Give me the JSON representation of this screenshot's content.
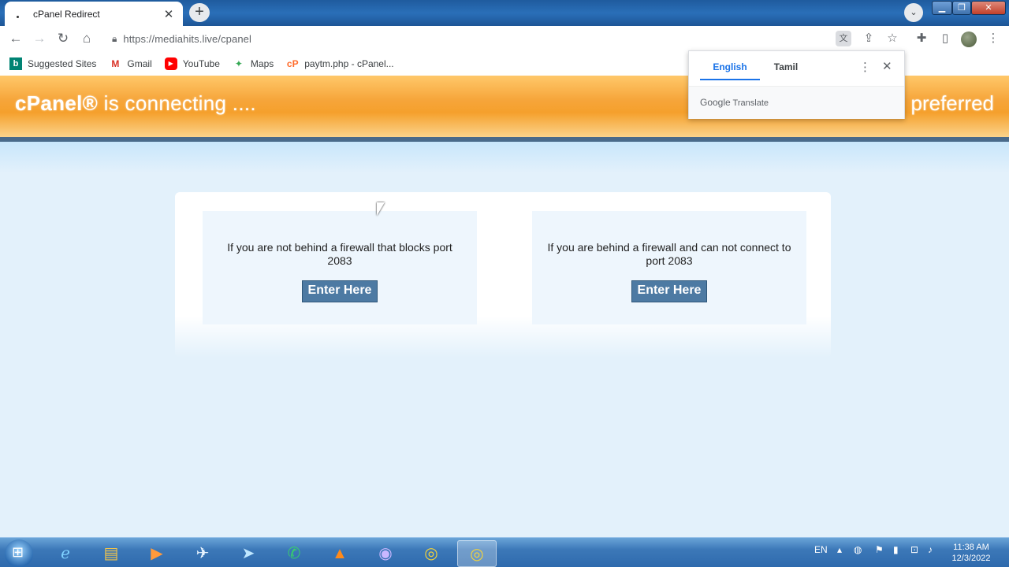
{
  "browser": {
    "tab_title": "cPanel Redirect",
    "tab_close": "✕",
    "new_tab": "+",
    "tab_search": "⌄",
    "url": "https://mediahits.live/cpanel",
    "window_controls": {
      "minimize": "▁",
      "maximize": "❐",
      "close": "✕"
    },
    "nav": {
      "back": "←",
      "forward": "→",
      "reload": "↻",
      "home": "⌂"
    }
  },
  "bookmarks": [
    {
      "label": "Suggested Sites",
      "icon": "bing-icon",
      "glyph": "b"
    },
    {
      "label": "Gmail",
      "icon": "gmail-icon",
      "glyph": "M"
    },
    {
      "label": "YouTube",
      "icon": "youtube-icon",
      "glyph": "▶"
    },
    {
      "label": "Maps",
      "icon": "maps-icon",
      "glyph": "✦"
    },
    {
      "label": "paytm.php - cPanel...",
      "icon": "cpanel-icon",
      "glyph": "cP"
    }
  ],
  "page": {
    "header_brand_bold": "cPanel®",
    "header_brand_rest": " is connecting ....",
    "header_right": "preferred",
    "options": [
      {
        "message": "If you are not behind a firewall that blocks port 2083",
        "button": "Enter Here"
      },
      {
        "message": "If you are behind a firewall and can not connect to port 2083",
        "button": "Enter Here"
      }
    ]
  },
  "translate_popup": {
    "tabs": [
      "English",
      "Tamil"
    ],
    "active_tab": "English",
    "footer_brand": "Google",
    "footer_text": " Translate"
  },
  "taskbar": {
    "language": "EN",
    "time": "11:38 AM",
    "date": "12/3/2022"
  },
  "colors": {
    "header_orange": "#f5a02c",
    "button_blue": "#4d7aa3",
    "link_blue": "#1a73e8",
    "background": "#e3f1fb"
  }
}
